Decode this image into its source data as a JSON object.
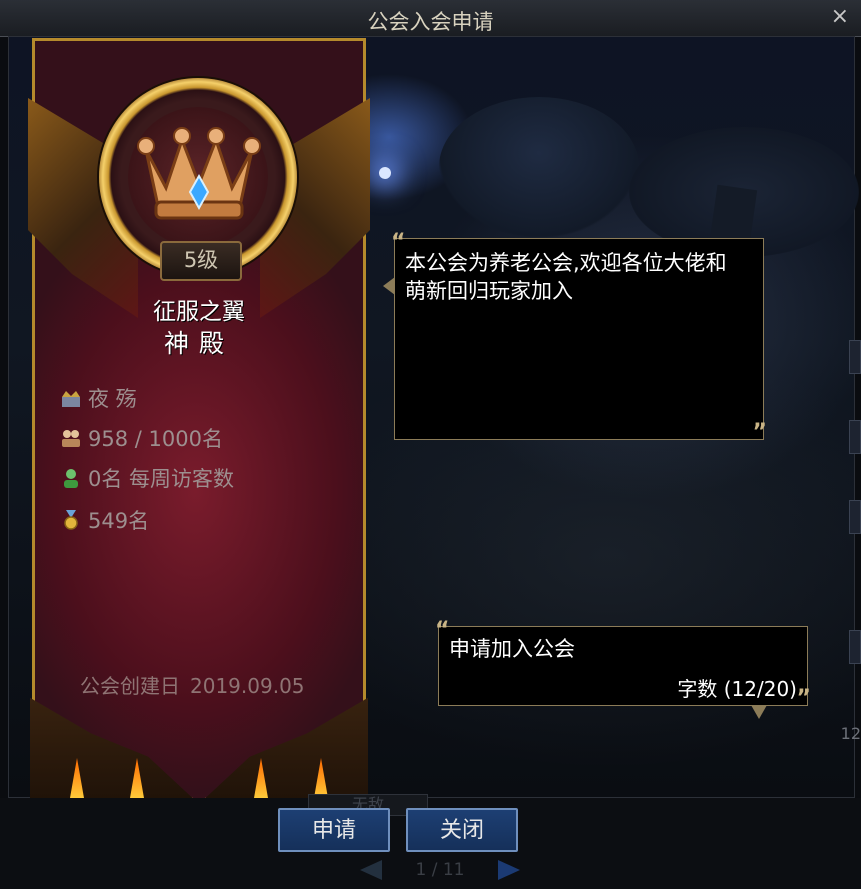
{
  "window": {
    "title": "公会入会申请",
    "close_glyph": "×"
  },
  "guild": {
    "level": "5级",
    "name_line1": "征服之翼",
    "name_line2": "神殿",
    "master": "夜 殇",
    "members": "958 / 1000名",
    "weekly_visitors": "0名 每周访客数",
    "rank": "549名",
    "founded_label": "公会创建日",
    "founded_date": "2019.09.05",
    "introduction": "本公会为养老公会,欢迎各位大佬和萌新回归玩家加入"
  },
  "application": {
    "message": "申请加入公会",
    "char_count": "字数 (12/20)"
  },
  "buttons": {
    "apply": "申请",
    "close": "关闭"
  },
  "background": {
    "tab_label": "无敌",
    "pager_text": "1 / 11",
    "side_number": "12"
  },
  "icons": {
    "master": "crown-person-icon",
    "members": "people-icon",
    "visitors": "person-icon",
    "rank": "medal-icon"
  },
  "colors": {
    "button_bg": "#1d3f73",
    "banner_red": "#7a1c2c",
    "gold": "#c8962e"
  }
}
